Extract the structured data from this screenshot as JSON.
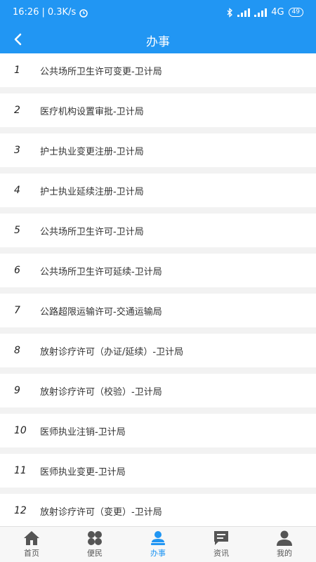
{
  "status": {
    "time": "16:26",
    "speed": "0.3K/s",
    "network": "4G",
    "battery": "49"
  },
  "header": {
    "title": "办事"
  },
  "items": [
    {
      "num": "1",
      "name": "公共场所卫生许可变更-卫计局"
    },
    {
      "num": "2",
      "name": "医疗机构设置审批-卫计局"
    },
    {
      "num": "3",
      "name": "护士执业变更注册-卫计局"
    },
    {
      "num": "4",
      "name": "护士执业延续注册-卫计局"
    },
    {
      "num": "5",
      "name": "公共场所卫生许可-卫计局"
    },
    {
      "num": "6",
      "name": "公共场所卫生许可延续-卫计局"
    },
    {
      "num": "7",
      "name": "公路超限运输许可-交通运输局"
    },
    {
      "num": "8",
      "name": "放射诊疗许可（办证/延续）-卫计局"
    },
    {
      "num": "9",
      "name": "放射诊疗许可（校验）-卫计局"
    },
    {
      "num": "10",
      "name": "医师执业注销-卫计局"
    },
    {
      "num": "11",
      "name": "医师执业变更-卫计局"
    },
    {
      "num": "12",
      "name": "放射诊疗许可（变更）-卫计局"
    }
  ],
  "tabs": [
    {
      "label": "首页",
      "icon": "home-icon"
    },
    {
      "label": "便民",
      "icon": "clover-icon"
    },
    {
      "label": "办事",
      "icon": "user-stamp-icon",
      "active": true
    },
    {
      "label": "资讯",
      "icon": "message-icon"
    },
    {
      "label": "我的",
      "icon": "person-icon"
    }
  ],
  "colors": {
    "primary": "#2196f3",
    "inactive": "#555555"
  }
}
